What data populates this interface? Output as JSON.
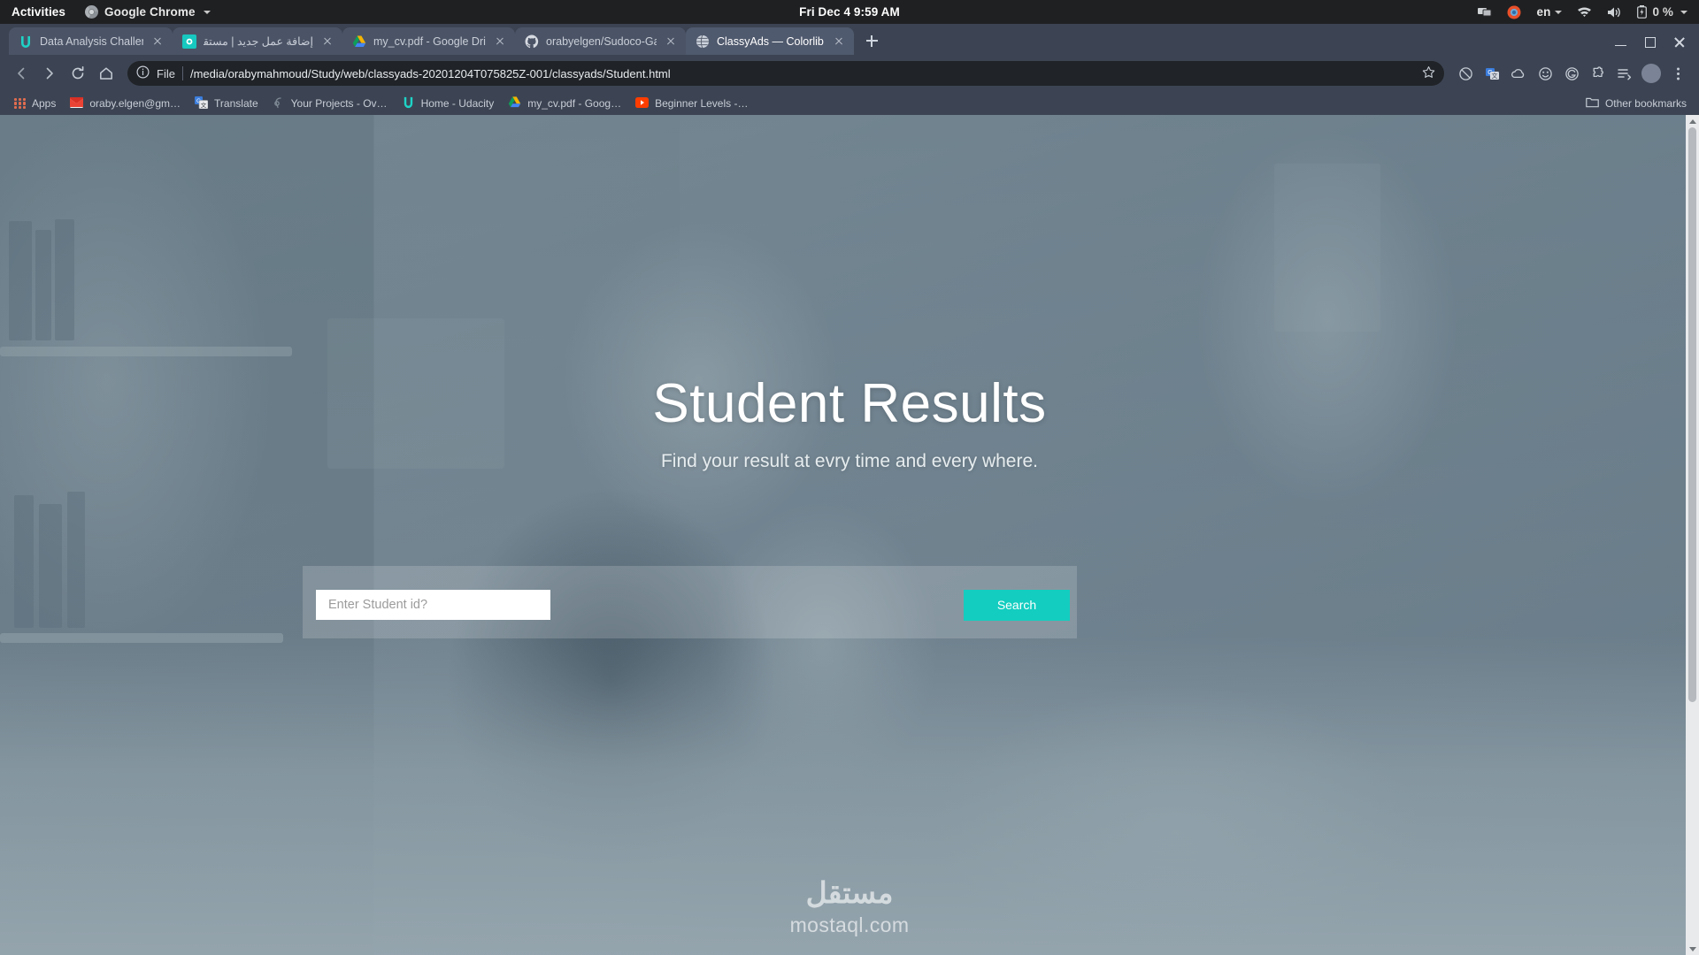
{
  "desktop": {
    "activities": "Activities",
    "app_menu": "Google Chrome",
    "clock": "Fri Dec 4  9:59 AM",
    "tray": {
      "screencast_icon": "screen-share-icon",
      "chrome_icon": "chrome-tray-icon",
      "language": "en",
      "wifi_icon": "wifi-icon",
      "volume_icon": "volume-icon",
      "battery_icon": "battery-icon",
      "battery_level": "0 %"
    }
  },
  "browser": {
    "tabs": [
      {
        "title": "Data Analysis Challenger - Ud",
        "favicon": "udacity-icon",
        "active": false,
        "rtl": false
      },
      {
        "title": "إضافة عمل جديد | مستقل",
        "favicon": "mostaql-icon",
        "active": false,
        "rtl": true
      },
      {
        "title": "my_cv.pdf - Google Drive",
        "favicon": "google-drive-icon",
        "active": false,
        "rtl": false
      },
      {
        "title": "orabyelgen/Sudoco-Game",
        "favicon": "github-icon",
        "active": false,
        "rtl": false
      },
      {
        "title": "ClassyAds — Colorlib Website",
        "favicon": "globe-icon",
        "active": true,
        "rtl": false
      }
    ],
    "new_tab_label": "+",
    "window_controls": {
      "minimize": "minimize-button",
      "maximize": "maximize-button",
      "close": "close-button"
    },
    "toolbar": {
      "back": "back-button",
      "forward": "forward-button",
      "reload": "reload-button",
      "home": "home-button",
      "info_icon": "site-info-icon",
      "scheme_label": "File",
      "url": "/media/orabymahmoud/Study/web/classyads-20201204T075825Z-001/classyads/Student.html",
      "bookmark_star": "bookmark-star-icon",
      "extensions": [
        "shield-icon",
        "translate-icon",
        "cloud-icon",
        "smiley-icon",
        "grammarly-icon",
        "puzzle-icon",
        "reading-list-icon",
        "screenshot-icon"
      ],
      "menu": "chrome-menu-icon"
    },
    "bookmarks": [
      {
        "label": "Apps",
        "icon": "apps-grid-icon"
      },
      {
        "label": "oraby.elgen@gm…",
        "icon": "gmail-icon"
      },
      {
        "label": "Translate",
        "icon": "translate-icon"
      },
      {
        "label": "Your Projects - Ov…",
        "icon": "project-icon"
      },
      {
        "label": "Home - Udacity",
        "icon": "udacity-icon"
      },
      {
        "label": "my_cv.pdf - Goog…",
        "icon": "google-drive-icon"
      },
      {
        "label": "Beginner Levels -…",
        "icon": "youtube-icon"
      }
    ],
    "other_bookmarks": {
      "label": "Other bookmarks",
      "icon": "folder-icon"
    }
  },
  "page": {
    "hero_title": "Student Results",
    "hero_subtitle": "Find your result at evry time and every where.",
    "search": {
      "placeholder": "Enter Student id?",
      "value": "",
      "button_label": "Search"
    },
    "watermark": {
      "arabic": "مستقل",
      "latin": "mostaql.com"
    },
    "accent_color": "#13cdc0"
  }
}
